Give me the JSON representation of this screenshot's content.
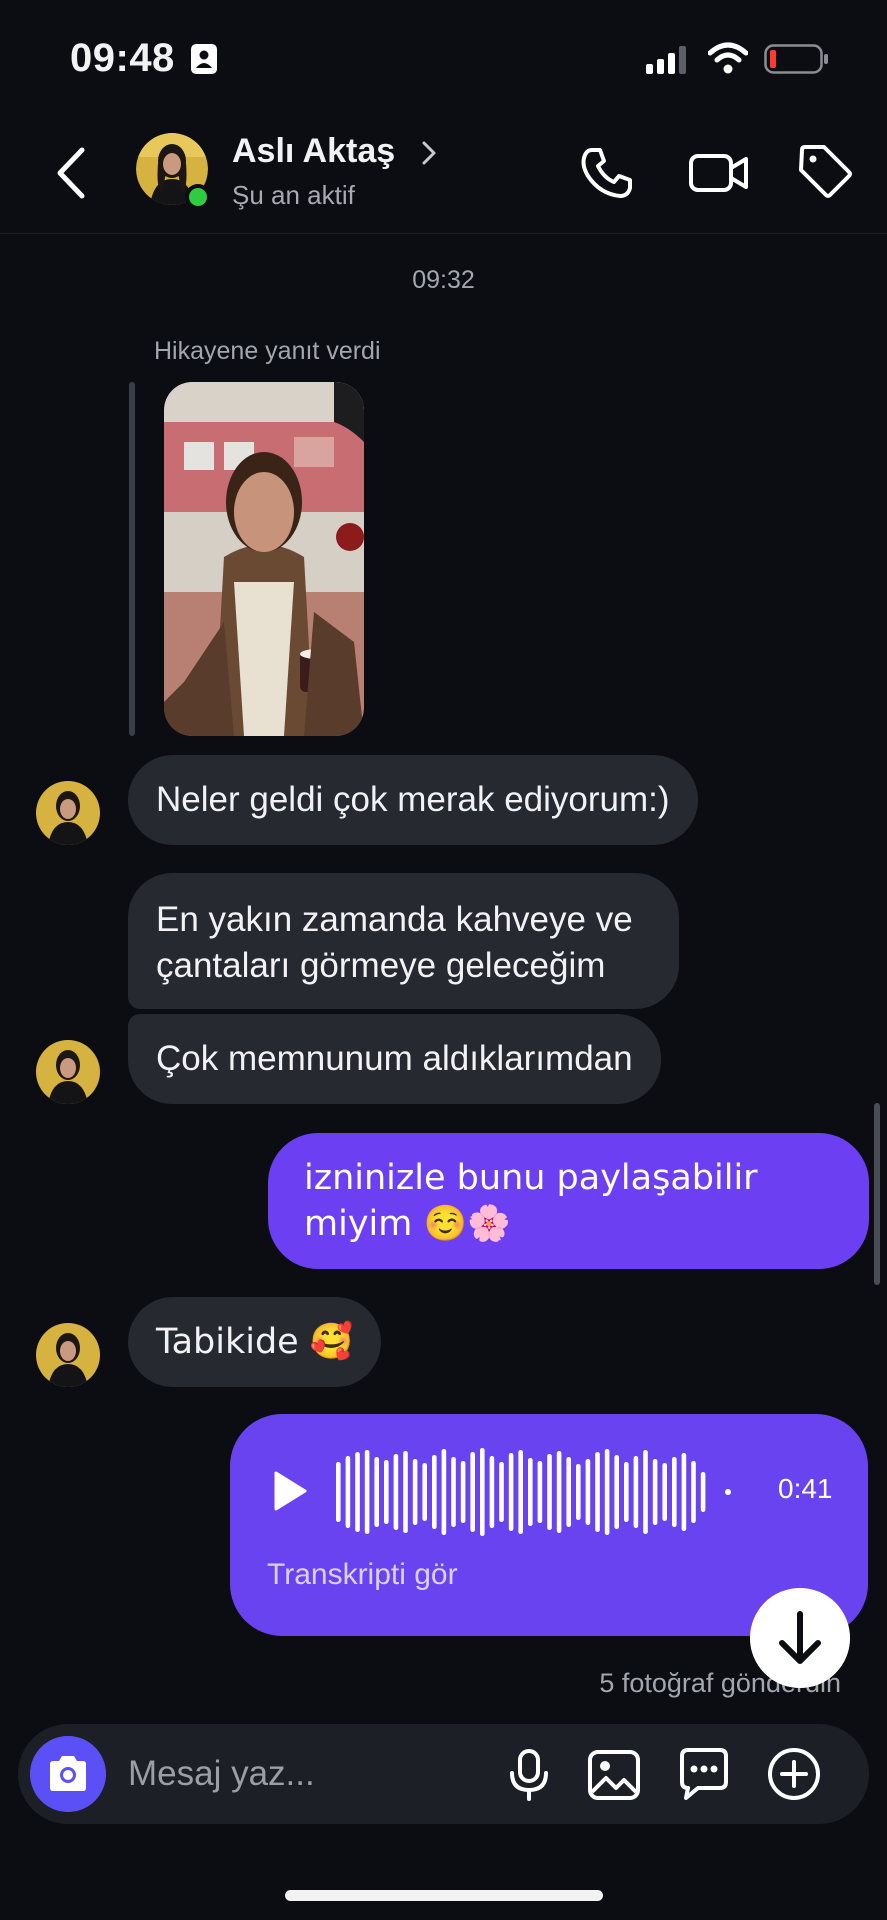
{
  "status_bar": {
    "time": "09:48"
  },
  "header": {
    "contact_name": "Aslı Aktaş",
    "contact_status": "Şu an aktif"
  },
  "conversation": {
    "timestamp": "09:32",
    "story_reply_label": "Hikayene yanıt verdi",
    "messages": [
      {
        "sender": "contact",
        "text": "Neler geldi çok merak ediyorum:)"
      },
      {
        "sender": "contact",
        "text": "En yakın zamanda kahveye ve çantaları görmeye geleceğim"
      },
      {
        "sender": "contact",
        "text": "Çok memnunum aldıklarımdan"
      },
      {
        "sender": "me",
        "text": "izninizle bunu paylaşabilir miyim ☺️🌸"
      },
      {
        "sender": "contact",
        "text": "Tabikide 🥰"
      }
    ],
    "voice_message": {
      "duration": "0:41",
      "transcript_label": "Transkripti gör"
    },
    "photos_sent_notice": "5 fotoğraf gönderdin"
  },
  "composer": {
    "placeholder": "Mesaj yaz..."
  },
  "colors": {
    "background": "#0b0d12",
    "incoming_bubble": "#262930",
    "outgoing_bubble": "#6c3ff2",
    "camera_button": "#5b50f6",
    "online_indicator": "#2ecc40",
    "battery_low": "#ff3b30"
  }
}
